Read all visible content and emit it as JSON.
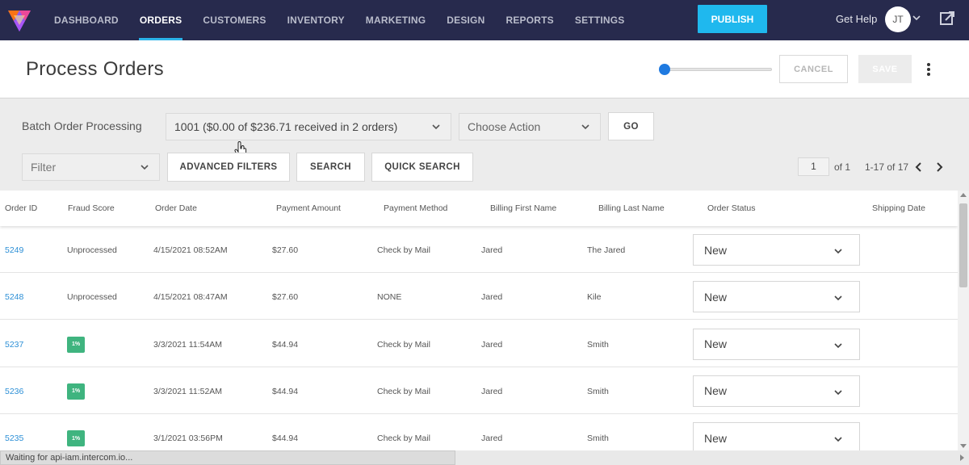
{
  "nav": {
    "items": [
      {
        "label": "DASHBOARD"
      },
      {
        "label": "ORDERS",
        "active": true
      },
      {
        "label": "CUSTOMERS"
      },
      {
        "label": "INVENTORY"
      },
      {
        "label": "MARKETING"
      },
      {
        "label": "DESIGN"
      },
      {
        "label": "REPORTS"
      },
      {
        "label": "SETTINGS"
      }
    ],
    "publish_label": "PUBLISH",
    "help_label": "Get Help",
    "avatar_initials": "JT",
    "colors": {
      "bar": "#272a4d",
      "publish": "#1fb8ee",
      "active_underline": "#2bb3e8"
    }
  },
  "header": {
    "title": "Process Orders",
    "cancel_label": "CANCEL",
    "save_label": "SAVE"
  },
  "controls": {
    "batch_label": "Batch Order Processing",
    "batch_value": "1001 ($0.00 of $236.71 received in 2 orders)",
    "action_placeholder": "Choose Action",
    "go_label": "GO",
    "filter_placeholder": "Filter",
    "advanced_filters_label": "ADVANCED FILTERS",
    "search_label": "SEARCH",
    "quick_search_label": "QUICK SEARCH"
  },
  "pagination": {
    "current_page": "1",
    "of_label": "of 1",
    "range_label": "1-17 of 17"
  },
  "table": {
    "columns": [
      "Order ID",
      "Fraud Score",
      "Order Date",
      "Payment Amount",
      "Payment Method",
      "Billing First Name",
      "Billing Last Name",
      "Order Status",
      "Shipping Date"
    ],
    "rows": [
      {
        "order_id": "5249",
        "fraud_score": "Unprocessed",
        "order_date": "4/15/2021 08:52AM",
        "payment_amount": "$27.60",
        "payment_method": "Check by Mail",
        "first_name": "Jared",
        "last_name": "The Jared",
        "status": "New"
      },
      {
        "order_id": "5248",
        "fraud_score": "Unprocessed",
        "order_date": "4/15/2021 08:47AM",
        "payment_amount": "$27.60",
        "payment_method": "NONE",
        "first_name": "Jared",
        "last_name": "Kile",
        "status": "New"
      },
      {
        "order_id": "5237",
        "fraud_score": "1%",
        "order_date": "3/3/2021 11:54AM",
        "payment_amount": "$44.94",
        "payment_method": "Check by Mail",
        "first_name": "Jared",
        "last_name": "Smith",
        "status": "New"
      },
      {
        "order_id": "5236",
        "fraud_score": "1%",
        "order_date": "3/3/2021 11:52AM",
        "payment_amount": "$44.94",
        "payment_method": "Check by Mail",
        "first_name": "Jared",
        "last_name": "Smith",
        "status": "New"
      },
      {
        "order_id": "5235",
        "fraud_score": "1%",
        "order_date": "3/1/2021 03:56PM",
        "payment_amount": "$44.94",
        "payment_method": "Check by Mail",
        "first_name": "Jared",
        "last_name": "Smith",
        "status": "New"
      }
    ]
  },
  "status_bar": {
    "text": "Waiting for api-iam.intercom.io..."
  },
  "colors": {
    "link": "#2c8fd6",
    "fraud_badge": "#3fb47f"
  }
}
